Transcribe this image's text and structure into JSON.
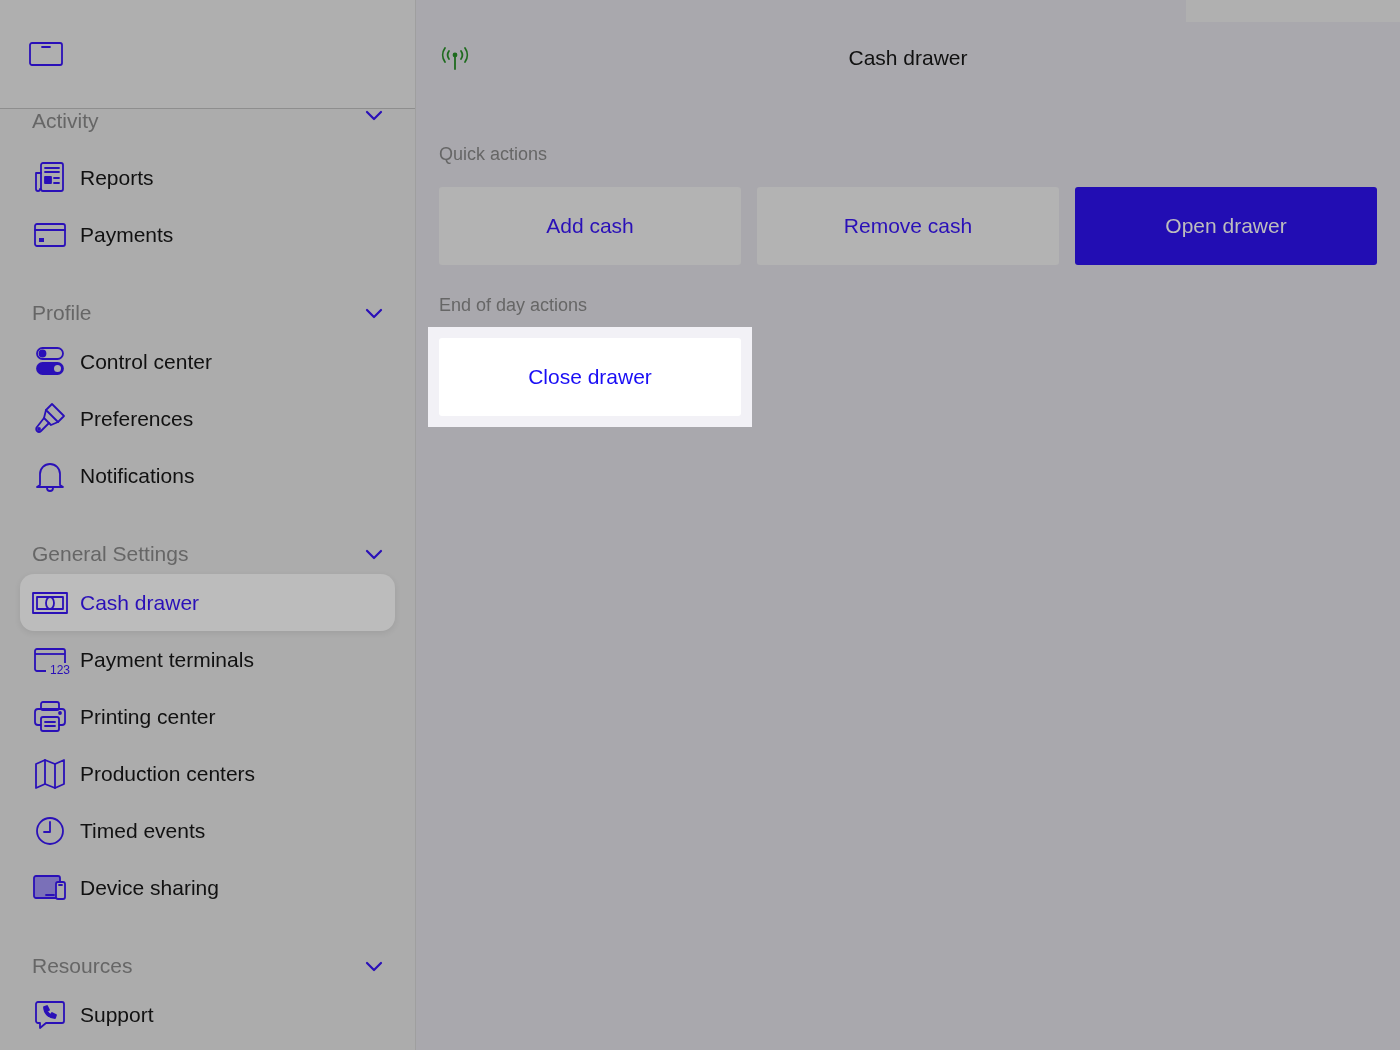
{
  "sidebar": {
    "groups": [
      {
        "title": "Activity",
        "expanded": true,
        "items": [
          {
            "label": "Reports",
            "selected": false
          },
          {
            "label": "Payments",
            "selected": false
          }
        ]
      },
      {
        "title": "Profile",
        "expanded": true,
        "items": [
          {
            "label": "Control center",
            "selected": false
          },
          {
            "label": "Preferences",
            "selected": false
          },
          {
            "label": "Notifications",
            "selected": false
          }
        ]
      },
      {
        "title": "General Settings",
        "expanded": true,
        "items": [
          {
            "label": "Cash drawer",
            "selected": true
          },
          {
            "label": "Payment terminals",
            "selected": false,
            "icon_text": "123"
          },
          {
            "label": "Printing center",
            "selected": false
          },
          {
            "label": "Production centers",
            "selected": false
          },
          {
            "label": "Timed events",
            "selected": false
          },
          {
            "label": "Device sharing",
            "selected": false
          }
        ]
      },
      {
        "title": "Resources",
        "expanded": true,
        "items": [
          {
            "label": "Support",
            "selected": false
          }
        ]
      }
    ]
  },
  "main": {
    "title": "Cash drawer",
    "sections": [
      {
        "title": "Quick actions",
        "buttons": [
          {
            "label": "Add cash",
            "kind": "secondary",
            "highlighted": false
          },
          {
            "label": "Remove cash",
            "kind": "secondary",
            "highlighted": false
          },
          {
            "label": "Open drawer",
            "kind": "primary",
            "highlighted": false
          }
        ]
      },
      {
        "title": "End of day actions",
        "buttons": [
          {
            "label": "Close drawer",
            "kind": "secondary",
            "highlighted": true
          }
        ]
      }
    ]
  }
}
